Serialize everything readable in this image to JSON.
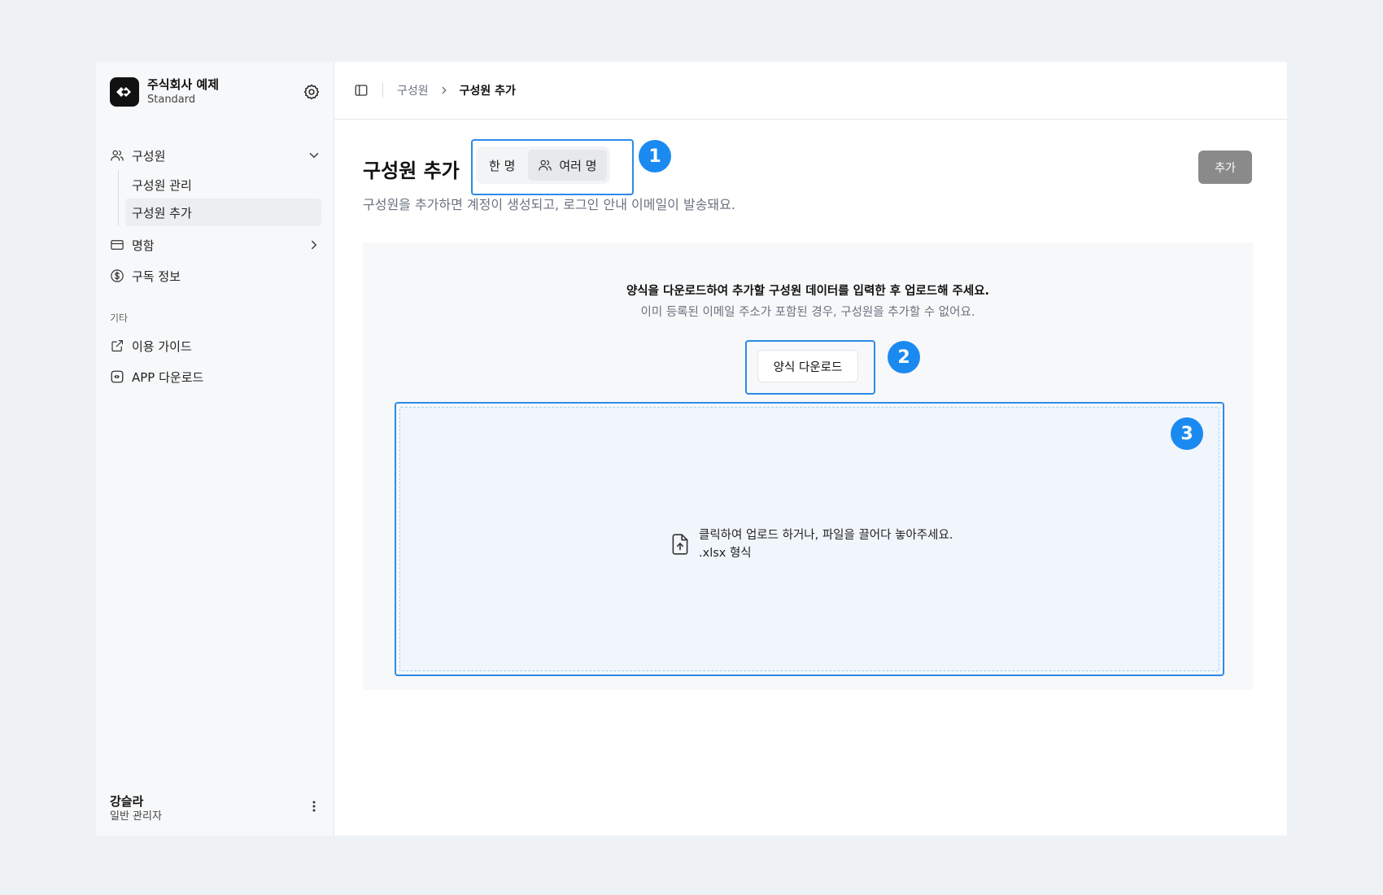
{
  "sidebar": {
    "org_name": "주식회사 예제",
    "org_plan": "Standard",
    "nav": {
      "members_label": "구성원",
      "members_sub": [
        "구성원 관리",
        "구성원 추가"
      ],
      "business_card_label": "명함",
      "subscription_label": "구독 정보"
    },
    "other_section": "기타",
    "guide_label": "이용 가이드",
    "app_download_label": "APP 다운로드",
    "user_name": "강슬라",
    "user_role": "일반 관리자"
  },
  "topbar": {
    "breadcrumb_parent": "구성원",
    "breadcrumb_current": "구성원 추가"
  },
  "page": {
    "title": "구성원 추가",
    "description": "구성원을 추가하면 계정이 생성되고, 로그인 안내 이메일이 발송돼요.",
    "segment": {
      "single_label": "한 명",
      "multi_label": "여러 명",
      "selected": "여러 명"
    },
    "add_button": "추가",
    "badges": [
      "1",
      "2",
      "3"
    ],
    "card": {
      "title": "양식을 다운로드하여 추가할 구성원 데이터를 입력한 후 업로드해 주세요.",
      "subtitle": "이미 등록된 이메일 주소가 포함된 경우, 구성원을 추가할 수 없어요.",
      "download_button": "양식 다운로드",
      "drop_text": "클릭하여 업로드 하거나, 파일을 끌어다 놓아주세요.",
      "drop_format": ".xlsx 형식"
    }
  },
  "colors": {
    "accent": "#1b8af0",
    "outline": "#2d8be8",
    "add_button_bg": "#8a8a8a",
    "drop_bg": "#f1f6fd"
  },
  "icons": [
    "brand-logo-icon",
    "gear-icon",
    "users-icon",
    "chevron-down-icon",
    "card-icon",
    "chevron-right-icon",
    "dollar-circle-icon",
    "external-link-icon",
    "app-icon",
    "more-vertical-icon",
    "sidebar-toggle-icon",
    "file-upload-icon"
  ]
}
